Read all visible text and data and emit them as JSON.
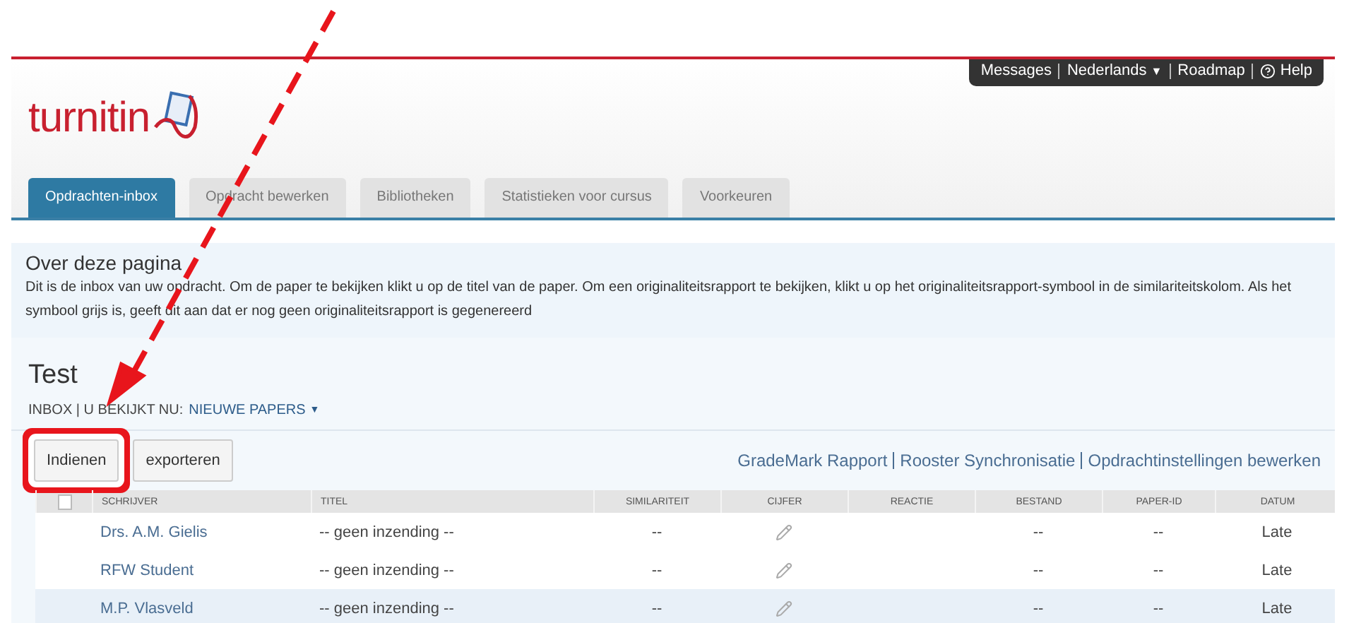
{
  "top_menu": [
    {
      "label": "Messages",
      "kind": "link"
    },
    {
      "label": "Nederlands",
      "kind": "dropdown",
      "caret": "▼"
    },
    {
      "label": "Roadmap",
      "kind": "link"
    },
    {
      "label": "Help",
      "kind": "help"
    }
  ],
  "logo": {
    "text": "turnitin"
  },
  "tabs": [
    {
      "label": "Opdrachten-inbox",
      "selected": true
    },
    {
      "label": "Opdracht bewerken",
      "selected": false
    },
    {
      "label": "Bibliotheken",
      "selected": false
    },
    {
      "label": "Statistieken voor cursus",
      "selected": false
    },
    {
      "label": "Voorkeuren",
      "selected": false
    }
  ],
  "about": {
    "title": "Over deze pagina",
    "text": "Dit is de inbox van uw opdracht. Om de paper te bekijken klikt u op de titel van de paper. Om een originaliteitsrapport te bekijken, klikt u op het originaliteitsrapport-symbool in de similariteitskolom. Als het symbool grijs is, geeft dit aan dat er nog geen originaliteitsrapport is gegenereerd"
  },
  "assignment": {
    "title": "Test",
    "breadcrumb": "INBOX  | U BEKIJKT NU:",
    "view": "NIEUWE PAPERS",
    "caret": "▼"
  },
  "buttons": [
    {
      "label": "Indienen",
      "highlighted": true
    },
    {
      "label": "exporteren",
      "highlighted": false
    }
  ],
  "links": [
    "GradeMark Rapport",
    "Rooster Synchronisatie",
    "Opdrachtinstellingen bewerken"
  ],
  "table": {
    "select_all": {
      "checked": false
    },
    "columns": [
      "SCHRIJVER",
      "TITEL",
      "SIMILARITEIT",
      "CIJFER",
      "REACTIE",
      "BESTAND",
      "PAPER-ID",
      "DATUM"
    ],
    "rows": [
      {
        "author": "Drs. A.M. Gielis",
        "title": "-- geen inzending --",
        "similarity": "--",
        "bestand": "--",
        "paper_id": "--",
        "date": "Late",
        "highlighted": false
      },
      {
        "author": "RFW Student",
        "title": "-- geen inzending --",
        "similarity": "--",
        "bestand": "--",
        "paper_id": "--",
        "date": "Late",
        "highlighted": false
      },
      {
        "author": "M.P. Vlasveld",
        "title": "-- geen inzending --",
        "similarity": "--",
        "bestand": "--",
        "paper_id": "--",
        "date": "Late",
        "highlighted": true
      }
    ]
  },
  "annotation": {
    "arrow": true
  }
}
